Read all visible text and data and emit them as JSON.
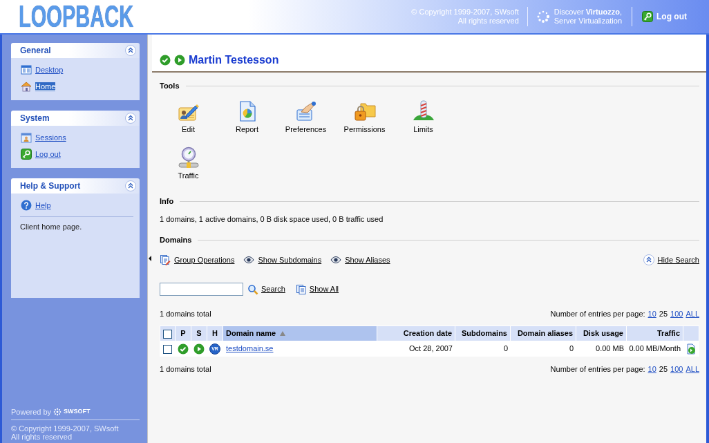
{
  "header": {
    "logo": "LOOPBACK",
    "copyright": [
      "© Copyright 1999-2007, SWsoft",
      "All rights reserved"
    ],
    "promo": [
      "Discover **Virtuozzo**,",
      "Server Virtualization"
    ],
    "logout": "Log out"
  },
  "sidebar": {
    "sections": [
      {
        "title": "General",
        "expanded": true,
        "items": [
          {
            "label": "Desktop",
            "kind": "desktop",
            "selected": false
          },
          {
            "label": "Home",
            "kind": "home",
            "selected": true
          }
        ]
      },
      {
        "title": "System",
        "expanded": true,
        "items": [
          {
            "label": "Sessions",
            "kind": "sessions",
            "selected": false
          },
          {
            "label": "Log out",
            "kind": "logout",
            "selected": false
          }
        ]
      },
      {
        "title": "Help & Support",
        "expanded": true,
        "items": [
          {
            "label": "Help",
            "kind": "help",
            "selected": false
          }
        ],
        "description": "Client home page."
      }
    ],
    "footer": {
      "powered_by": "Powered by",
      "brand": "SWSOFT",
      "copyright": [
        "© Copyright 1999-2007, SWsoft",
        "All rights reserved"
      ]
    }
  },
  "account": {
    "name": "Martin Testesson",
    "status_ok": true,
    "active": true
  },
  "tools": {
    "title": "Tools",
    "items": [
      {
        "label": "Edit",
        "kind": "edit"
      },
      {
        "label": "Report",
        "kind": "report"
      },
      {
        "label": "Preferences",
        "kind": "preferences"
      },
      {
        "label": "Permissions",
        "kind": "permissions"
      },
      {
        "label": "Limits",
        "kind": "limits"
      },
      {
        "label": "Traffic",
        "kind": "traffic"
      }
    ]
  },
  "info": {
    "title": "Info",
    "text": "1 domains, 1 active domains, 0 B disk space used, 0 B traffic used"
  },
  "domains": {
    "title": "Domains",
    "actions": [
      {
        "label": "Group Operations",
        "kind": "group"
      },
      {
        "label": "Show Subdomains",
        "kind": "show"
      },
      {
        "label": "Show Aliases",
        "kind": "show"
      }
    ],
    "search_toggle": {
      "label": "Hide Search",
      "expanded": true
    },
    "search": {
      "button": "Search",
      "show_all": "Show All"
    },
    "pager_top": {
      "total": "1 domains total",
      "label": "Number of entries per page:",
      "options": [
        {
          "label": "10",
          "selected": false
        },
        {
          "label": "25",
          "selected": true
        },
        {
          "label": "100",
          "selected": false
        },
        {
          "label": "ALL",
          "selected": false
        }
      ]
    },
    "table": {
      "select_all": false,
      "columns": [
        {
          "label": "P",
          "kind": "icon",
          "sorted": false
        },
        {
          "label": "S",
          "kind": "icon",
          "sorted": false
        },
        {
          "label": "H",
          "kind": "icon",
          "sorted": false
        },
        {
          "label": "Domain name",
          "kind": "text",
          "sorted": true
        },
        {
          "label": "Creation date",
          "kind": "number",
          "sorted": false
        },
        {
          "label": "Subdomains",
          "kind": "number",
          "sorted": false
        },
        {
          "label": "Domain aliases",
          "kind": "number",
          "sorted": false
        },
        {
          "label": "Disk usage",
          "kind": "number",
          "sorted": false
        },
        {
          "label": "Traffic",
          "kind": "number",
          "sorted": false
        }
      ],
      "rows": [
        {
          "checked": false,
          "cells": [
            {
              "kind": "status",
              "ok": true
            },
            {
              "kind": "state",
              "on": true
            },
            {
              "kind": "badge",
              "text": "VR"
            },
            {
              "kind": "link",
              "text": "testdomain.se"
            },
            {
              "kind": "text",
              "text": "Oct 28, 2007"
            },
            {
              "kind": "text",
              "text": "0"
            },
            {
              "kind": "text",
              "text": "0"
            },
            {
              "kind": "text",
              "text": "0.00 MB"
            },
            {
              "kind": "text",
              "text": "0.00 MB/Month"
            }
          ]
        }
      ]
    },
    "pager_bottom": {
      "total": "1 domains total",
      "label": "Number of entries per page:",
      "options": [
        {
          "label": "10",
          "selected": false
        },
        {
          "label": "25",
          "selected": true
        },
        {
          "label": "100",
          "selected": false
        },
        {
          "label": "ALL",
          "selected": false
        }
      ]
    }
  }
}
